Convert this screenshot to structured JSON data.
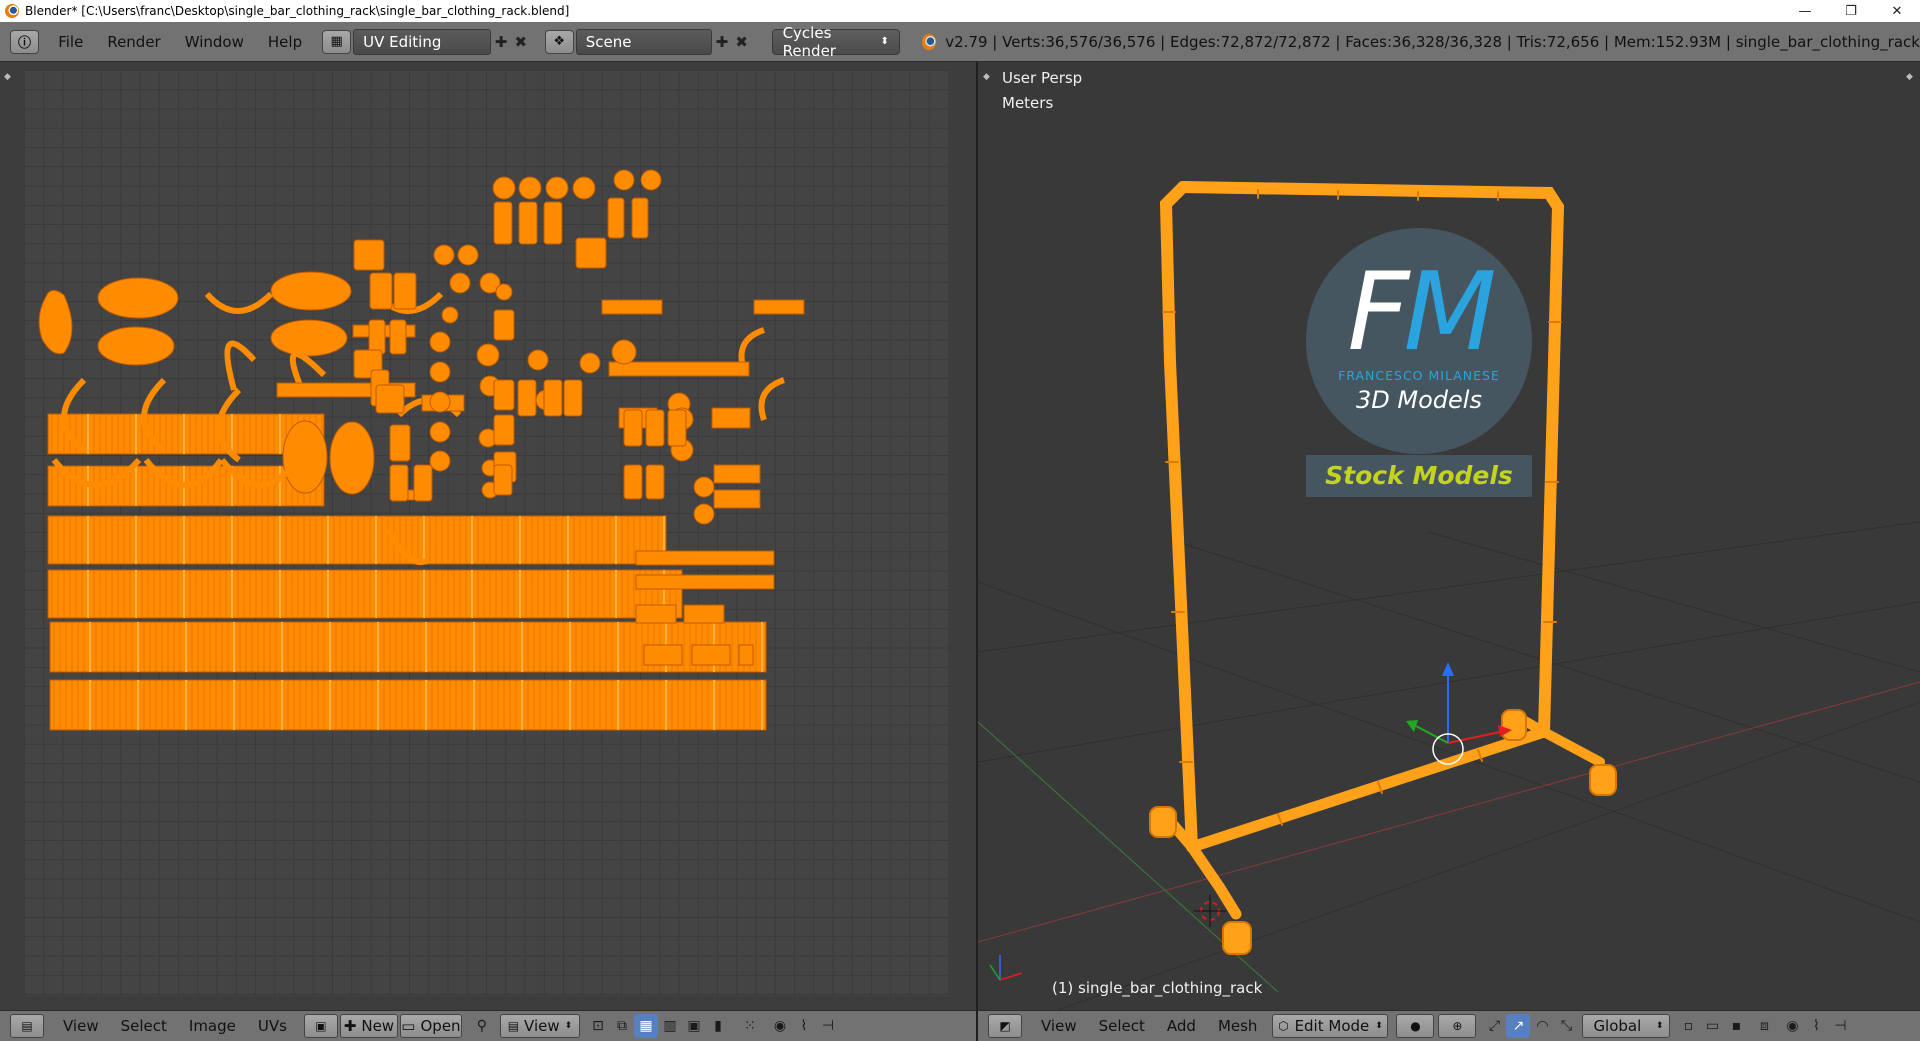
{
  "window": {
    "title": "Blender* [C:\\Users\\franc\\Desktop\\single_bar_clothing_rack\\single_bar_clothing_rack.blend]",
    "minimize": "—",
    "maximize": "❐",
    "close": "✕"
  },
  "info_header": {
    "menus": [
      "File",
      "Render",
      "Window",
      "Help"
    ],
    "layout": "UV Editing",
    "scene": "Scene",
    "render_engine": "Cycles Render",
    "stats": "v2.79 | Verts:36,576/36,576 | Edges:72,872/72,872 | Faces:36,328/36,328 | Tris:72,656 | Mem:152.93M | single_bar_clothing_rack"
  },
  "uv_editor": {
    "menus": [
      "View",
      "Select",
      "Image",
      "UVs"
    ],
    "new_label": "New",
    "open_label": "Open",
    "view_label": "View"
  },
  "viewport": {
    "view_name": "User Persp",
    "units": "Meters",
    "object_label": "(1) single_bar_clothing_rack",
    "menus": [
      "View",
      "Select",
      "Add",
      "Mesh"
    ],
    "mode": "Edit Mode",
    "orientation": "Global",
    "logo": {
      "initials_f": "F",
      "initials_m": "M",
      "author": "FRANCESCO MILANESE",
      "subtitle": "3D Models",
      "badge": "Stock Models"
    }
  },
  "colors": {
    "uv_island": "#ff8c00",
    "rack": "#ffa21a",
    "header": "#727272",
    "background": "#3d3d3d",
    "accent_blue": "#2aa3de",
    "badge_text": "#c4d31e"
  }
}
